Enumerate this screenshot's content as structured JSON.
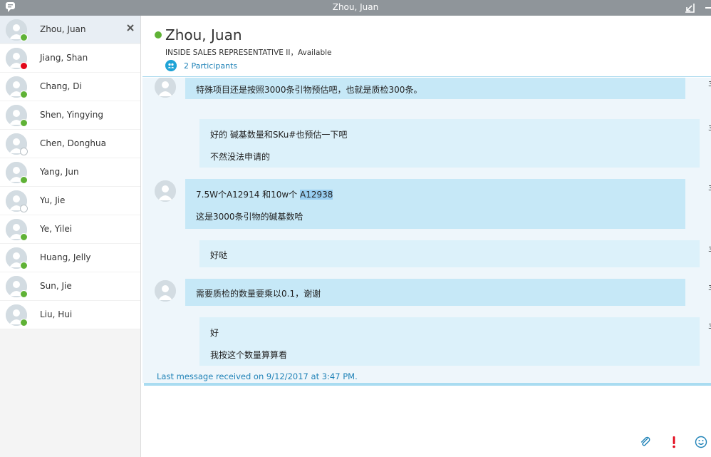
{
  "window": {
    "title": "Zhou, Juan"
  },
  "contacts": [
    {
      "name": "Zhou, Juan",
      "status": "available",
      "selected": true
    },
    {
      "name": "Jiang, Shan",
      "status": "busy"
    },
    {
      "name": "Chang, Di",
      "status": "available"
    },
    {
      "name": "Shen, Yingying",
      "status": "available"
    },
    {
      "name": "Chen, Donghua",
      "status": "offline"
    },
    {
      "name": "Yang, Jun",
      "status": "available"
    },
    {
      "name": "Yu, Jie",
      "status": "offline"
    },
    {
      "name": "Ye, Yilei",
      "status": "available"
    },
    {
      "name": "Huang, Jelly",
      "status": "available"
    },
    {
      "name": "Sun, Jie",
      "status": "available"
    },
    {
      "name": "Liu, Hui",
      "status": "available"
    }
  ],
  "header": {
    "name": "Zhou, Juan",
    "subtitle": "INSIDE SALES REPRESENTATIVE II，Available",
    "participants": "2 Participants"
  },
  "messages": [
    {
      "direction": "incoming",
      "lines": [
        "特殊项目还是按照3000条引物预估吧，也就是质检300条。"
      ]
    },
    {
      "direction": "outgoing",
      "lines": [
        "好的 碱基数量和SKu#也预估一下吧",
        "不然没法申请的"
      ]
    },
    {
      "direction": "incoming",
      "lines": [
        "7.5W个A12914 和10w个 A12938",
        "这是3000条引物的碱基数哈"
      ],
      "highlight": "A12938"
    },
    {
      "direction": "outgoing",
      "lines": [
        "好哒"
      ]
    },
    {
      "direction": "incoming",
      "lines": [
        "需要质检的数量要乘以0.1，谢谢"
      ]
    },
    {
      "direction": "outgoing",
      "lines": [
        "好",
        "我按这个数量算算看"
      ]
    }
  ],
  "timestamp_stub": "3",
  "status_line": "Last message received on 9/12/2017 at 3:47 PM.",
  "colors": {
    "available": "#5fb236",
    "busy": "#e2071a",
    "link": "#1f82b7",
    "incoming": "#c6e8f7",
    "outgoing": "#dcf1fa"
  },
  "toolbar": {
    "icons": [
      "paperclip-icon",
      "important-icon",
      "emoticon-icon"
    ]
  }
}
